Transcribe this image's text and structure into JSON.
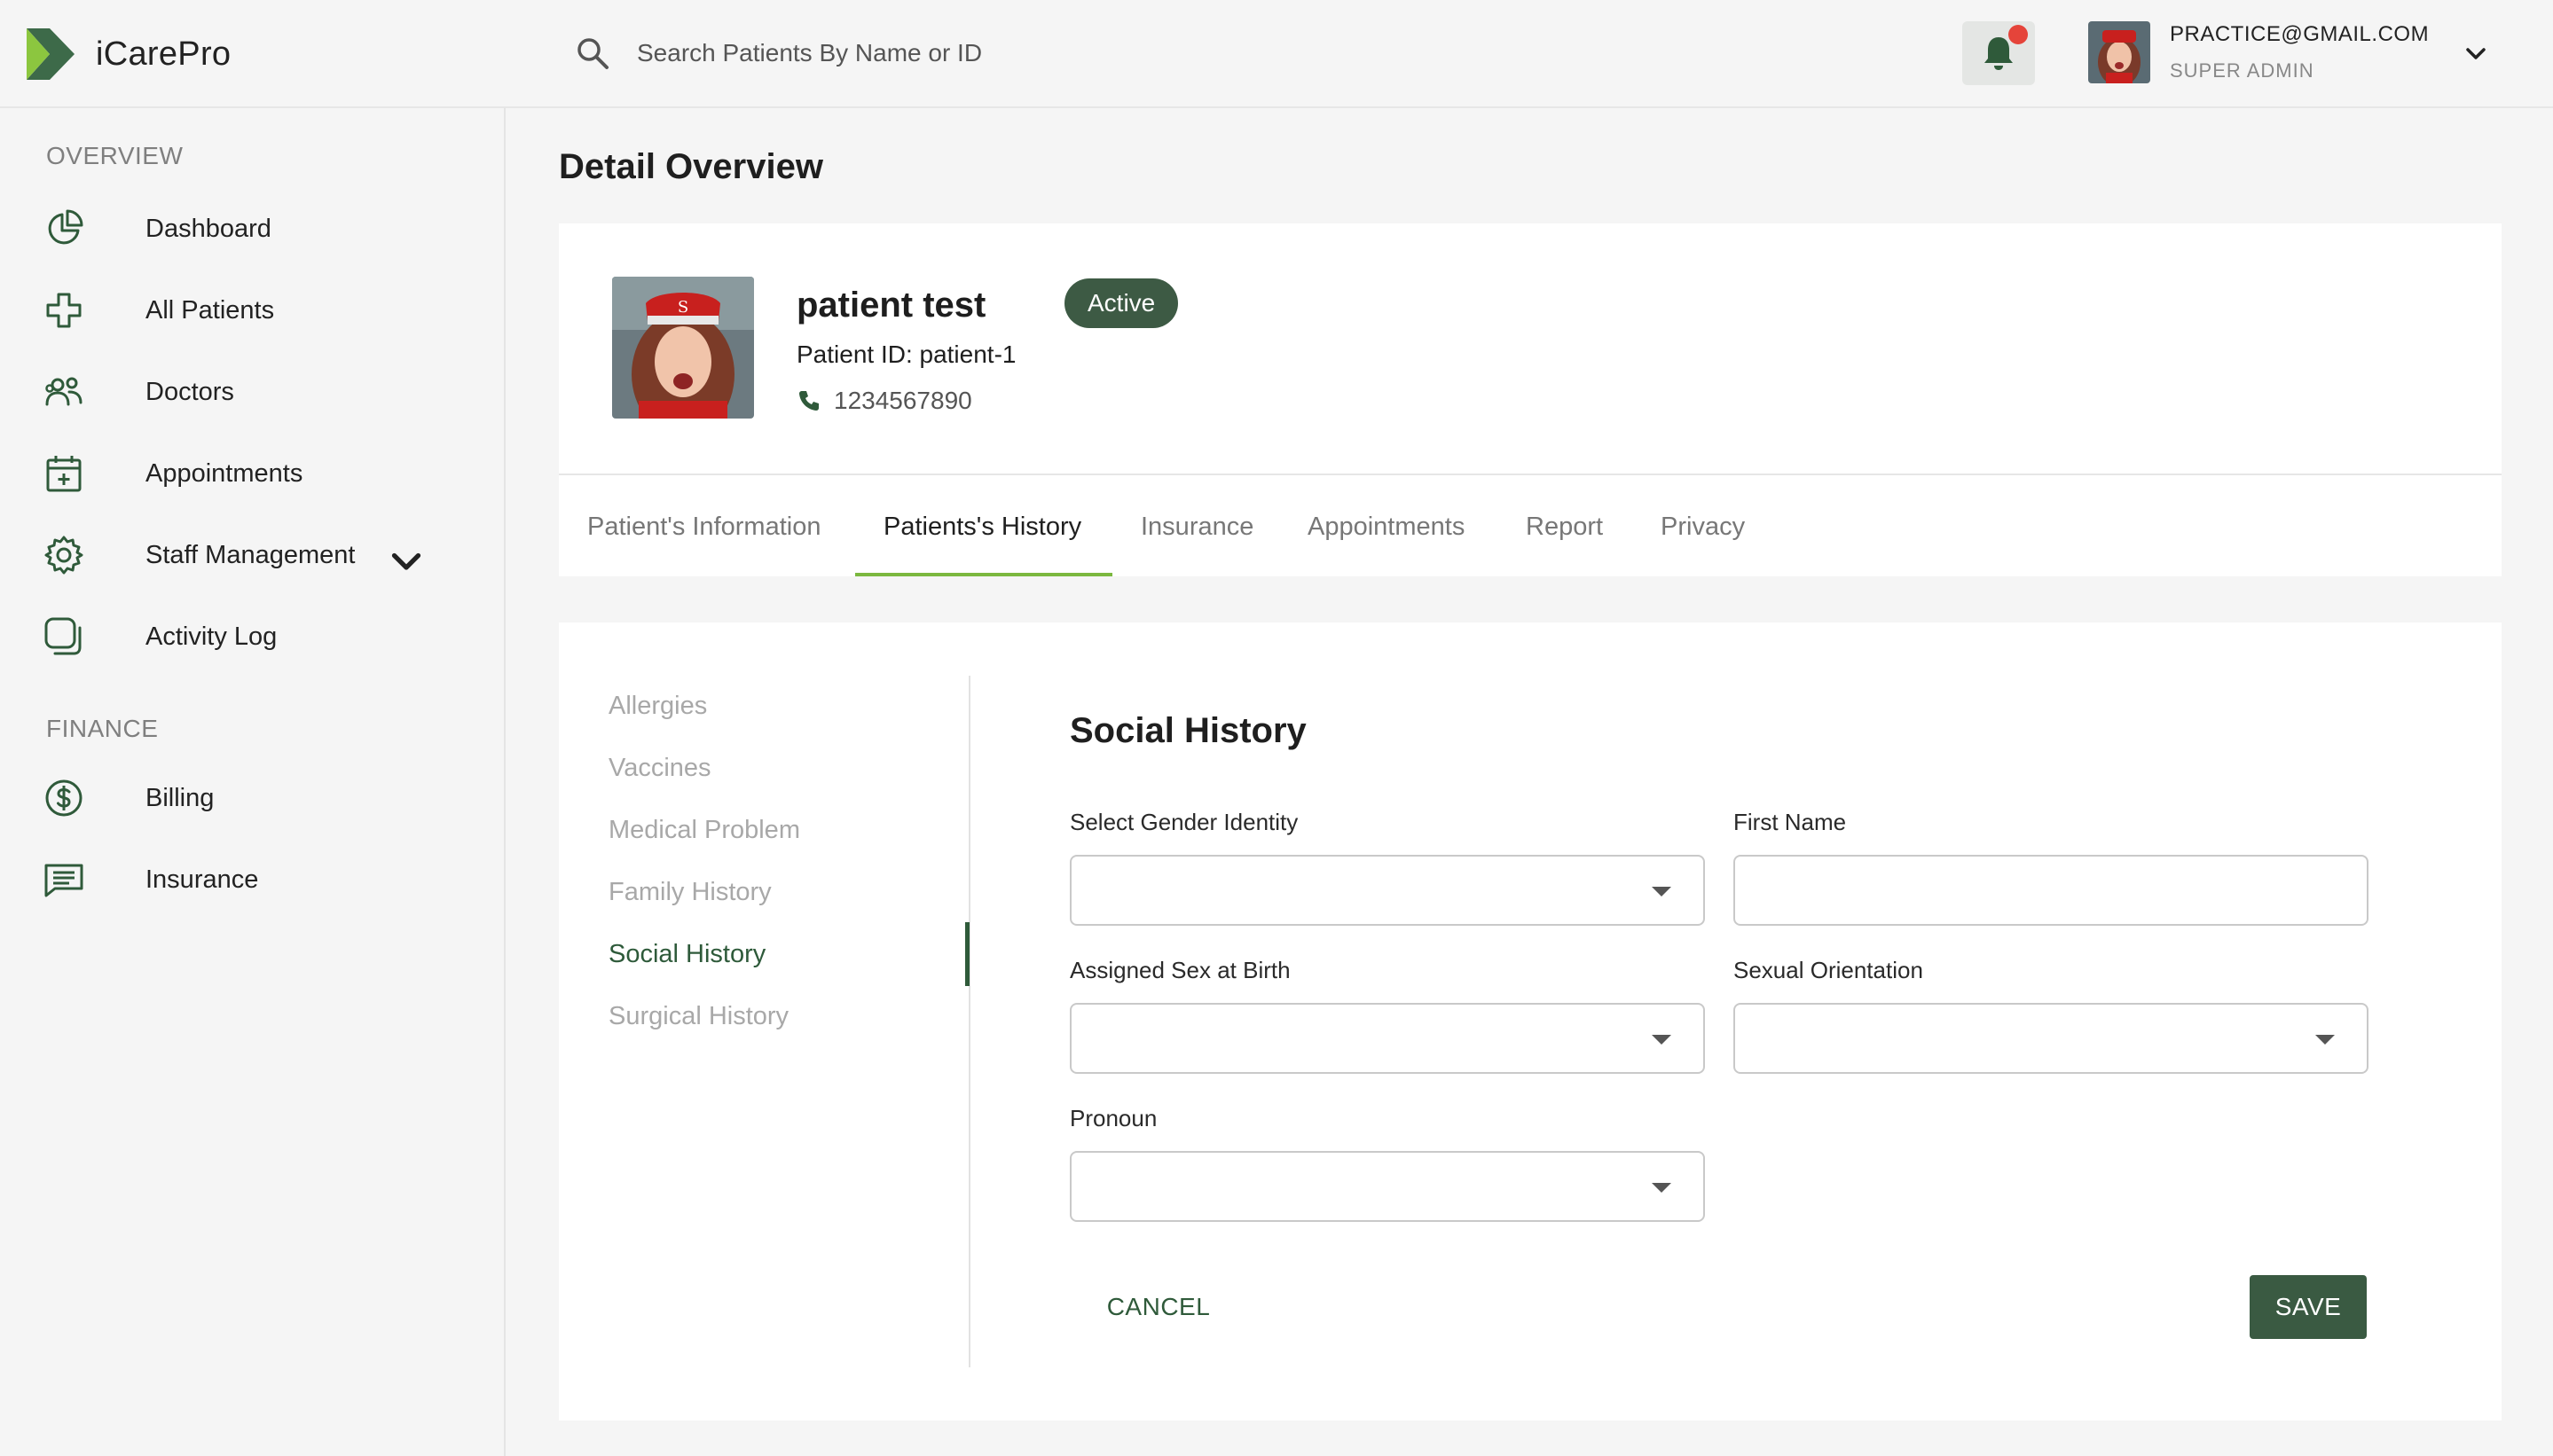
{
  "app": {
    "name": "iCarePro"
  },
  "search": {
    "placeholder": "Search Patients By Name or ID"
  },
  "user": {
    "email": "PRACTICE@GMAIL.COM",
    "role": "SUPER ADMIN"
  },
  "sidebar": {
    "sections": [
      {
        "title": "OVERVIEW",
        "items": [
          {
            "label": "Dashboard",
            "icon": "pie-chart-icon"
          },
          {
            "label": "All Patients",
            "icon": "medical-cross-icon"
          },
          {
            "label": "Doctors",
            "icon": "people-icon"
          },
          {
            "label": "Appointments",
            "icon": "calendar-plus-icon"
          },
          {
            "label": "Staff Management",
            "icon": "gear-icon",
            "expandable": true
          },
          {
            "label": "Activity Log",
            "icon": "copy-icon"
          }
        ]
      },
      {
        "title": "FINANCE",
        "items": [
          {
            "label": "Billing",
            "icon": "dollar-circle-icon"
          },
          {
            "label": "Insurance",
            "icon": "receipt-icon"
          }
        ]
      }
    ]
  },
  "page": {
    "title": "Detail Overview"
  },
  "patient": {
    "name": "patient test",
    "status": "Active",
    "id_line": "Patient ID: patient-1",
    "phone": "1234567890"
  },
  "tabs": [
    {
      "label": "Patient's Information",
      "active": false
    },
    {
      "label": "Patients's History",
      "active": true
    },
    {
      "label": "Insurance",
      "active": false
    },
    {
      "label": "Appointments",
      "active": false
    },
    {
      "label": "Report",
      "active": false
    },
    {
      "label": "Privacy",
      "active": false
    }
  ],
  "history_nav": [
    {
      "label": "Allergies",
      "active": false
    },
    {
      "label": "Vaccines",
      "active": false
    },
    {
      "label": "Medical Problem",
      "active": false
    },
    {
      "label": "Family History",
      "active": false
    },
    {
      "label": "Social History",
      "active": true
    },
    {
      "label": "Surgical History",
      "active": false
    }
  ],
  "form": {
    "title": "Social History",
    "fields": [
      {
        "label": "Select Gender Identity",
        "type": "select",
        "value": ""
      },
      {
        "label": "First Name",
        "type": "text",
        "value": ""
      },
      {
        "label": "Assigned Sex at Birth",
        "type": "select",
        "value": ""
      },
      {
        "label": "Sexual Orientation",
        "type": "select",
        "value": ""
      },
      {
        "label": "Pronoun",
        "type": "select",
        "value": ""
      }
    ],
    "cancel_label": "CANCEL",
    "save_label": "SAVE"
  },
  "colors": {
    "brand_green": "#3a5a42",
    "accent_underline": "#7bb83f",
    "notification": "#e5443a"
  }
}
